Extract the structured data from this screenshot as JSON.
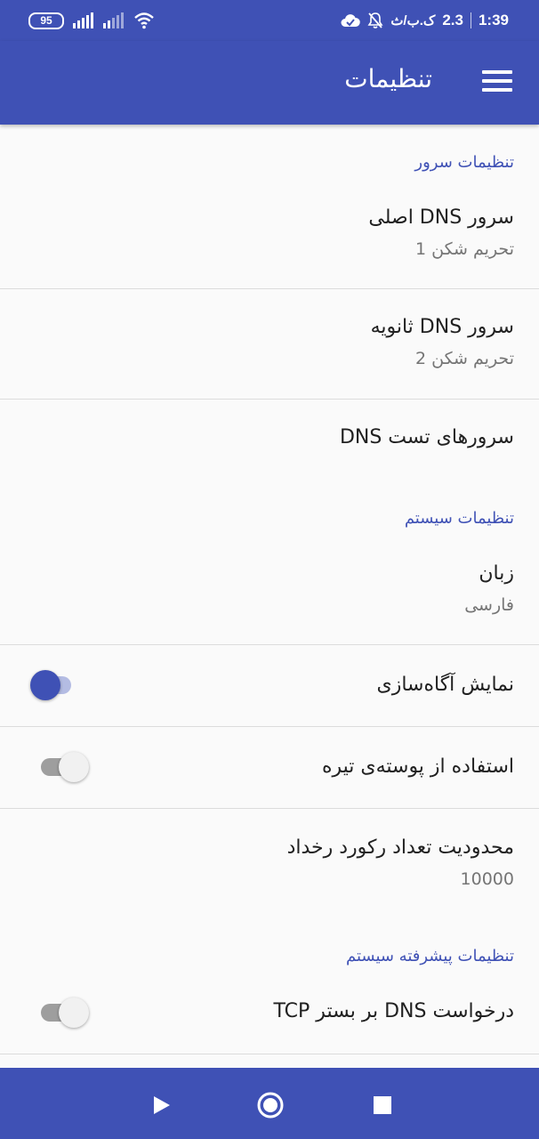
{
  "status_bar": {
    "battery": "95",
    "time": "1:39",
    "speed": "2.3",
    "speed_unit": "ک.ب/ث"
  },
  "app_bar": {
    "title": "تنظیمات",
    "menu_icon": "hamburger-menu-icon"
  },
  "sections": {
    "server": {
      "header": "تنظیمات سرور",
      "primary_dns": {
        "title": "سرور DNS اصلی",
        "summary": "تحریم شکن 1"
      },
      "secondary_dns": {
        "title": "سرور DNS ثانویه",
        "summary": "تحریم شکن 2"
      },
      "test_servers": {
        "title": "سرورهای تست DNS"
      }
    },
    "system": {
      "header": "تنظیمات سیستم",
      "language": {
        "title": "زبان",
        "summary": "فارسی"
      },
      "notification": {
        "title": "نمایش آگاه‌سازی",
        "enabled": true
      },
      "dark_theme": {
        "title": "استفاده از پوسته‌ی تیره",
        "enabled": false
      },
      "log_limit": {
        "title": "محدودیت تعداد رکورد رخداد",
        "summary": "10000"
      }
    },
    "advanced": {
      "header": "تنظیمات پیشرفته سیستم",
      "dns_over_tcp": {
        "title": "درخواست DNS بر بستر TCP",
        "enabled": false
      }
    }
  },
  "nav_bar": {
    "icons": [
      "play-icon",
      "circle-home-icon",
      "square-stop-icon"
    ]
  },
  "colors": {
    "primary": "#3f51b5",
    "switch_track_on": "#b4bce3",
    "text_primary": "#212121",
    "text_secondary": "#757575"
  }
}
